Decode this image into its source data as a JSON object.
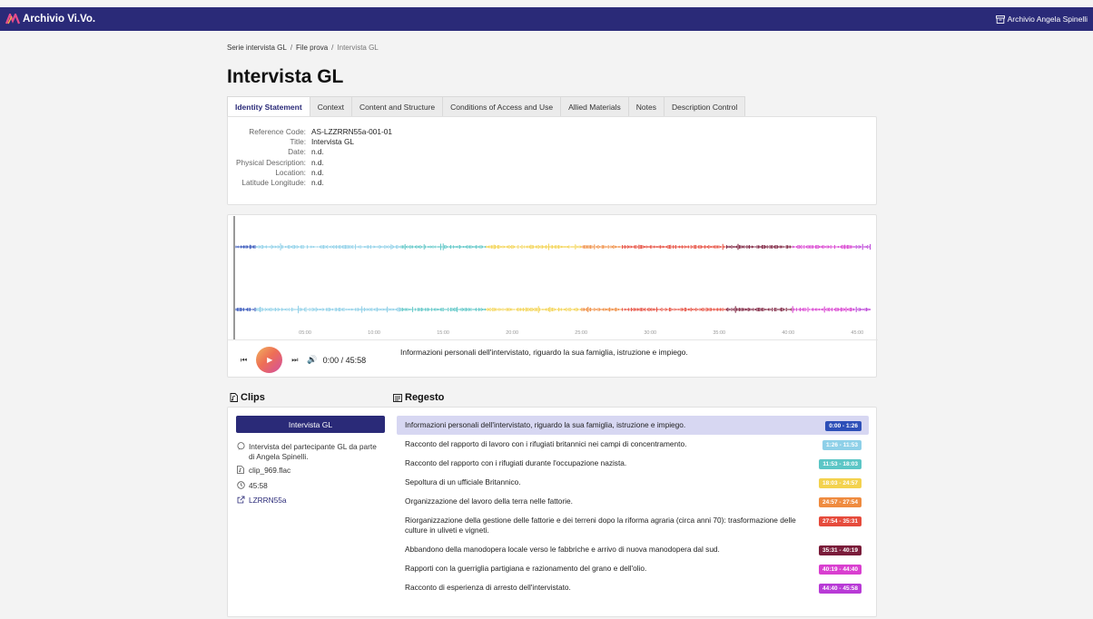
{
  "navbar": {
    "brand": "Archivio Vi.Vo.",
    "user": "Archivio Angela Spinelli"
  },
  "breadcrumb": {
    "items": [
      "Serie intervista GL",
      "File prova",
      "Intervista GL"
    ],
    "separator": "/"
  },
  "page": {
    "title": "Intervista GL"
  },
  "tabs": [
    {
      "label": "Identity Statement",
      "active": true
    },
    {
      "label": "Context"
    },
    {
      "label": "Content and Structure"
    },
    {
      "label": "Conditions of Access and Use"
    },
    {
      "label": "Allied Materials"
    },
    {
      "label": "Notes"
    },
    {
      "label": "Description Control"
    }
  ],
  "identity": {
    "rows": [
      {
        "label": "Reference Code:",
        "value": "AS-LZZRRN55a-001-01"
      },
      {
        "label": "Title:",
        "value": "Intervista GL"
      },
      {
        "label": "Date:",
        "value": "n.d."
      },
      {
        "label": "Physical Description:",
        "value": "n.d."
      },
      {
        "label": "Location:",
        "value": "n.d."
      },
      {
        "label": "Latitude Longitude:",
        "value": "n.d."
      }
    ]
  },
  "player": {
    "timeline_ticks": [
      "05:00",
      "10:00",
      "15:00",
      "20:00",
      "25:00",
      "30:00",
      "35:00",
      "40:00",
      "45:00"
    ],
    "current_time": "0:00 / 45:58",
    "now_text": "Informazioni personali dell'intervistato, riguardo la sua famiglia, istruzione e impiego.",
    "prev_icon": "⏮",
    "next_icon": "⏭",
    "volume_icon": "🔊",
    "play_icon": "▶"
  },
  "clips": {
    "title": "Clips",
    "button": "Intervista GL",
    "description": "Intervista del partecipante GL da parte di Angela Spinelli.",
    "file": "clip_969.flac",
    "duration": "45:58",
    "link": "LZRRN55a"
  },
  "regesto": {
    "title": "Regesto",
    "items": [
      {
        "text": "Informazioni personali dell'intervistato, riguardo la sua famiglia, istruzione e impiego.",
        "range": "0:00 - 1:26",
        "color": "#2d4fb8",
        "active": true
      },
      {
        "text": "Racconto del rapporto di lavoro con i rifugiati britannici nei campi di concentramento.",
        "range": "1:26 - 11:53",
        "color": "#8ed0e8"
      },
      {
        "text": "Racconto del rapporto con i rifugiati durante l'occupazione nazista.",
        "range": "11:53 - 18:03",
        "color": "#5cc6c6"
      },
      {
        "text": "Sepoltura di un ufficiale Britannico.",
        "range": "18:03 - 24:57",
        "color": "#f3d24e"
      },
      {
        "text": "Organizzazione del lavoro della terra nelle fattorie.",
        "range": "24:57 - 27:54",
        "color": "#ef8b3f"
      },
      {
        "text": "Riorganizzazione della gestione delle fattorie e dei terreni dopo la riforma agraria (circa anni 70): trasformazione delle culture in uliveti e vigneti.",
        "range": "27:54 - 35:31",
        "color": "#e64b3c"
      },
      {
        "text": "Abbandono della manodopera locale verso le fabbriche e arrivo di nuova manodopera dal sud.",
        "range": "35:31 - 40:19",
        "color": "#7a1c3a"
      },
      {
        "text": "Rapporti con la guerriglia partigiana e razionamento del grano e dell'olio.",
        "range": "40:19 - 44:40",
        "color": "#d93fd0"
      },
      {
        "text": "Racconto di esperienza di arresto dell'intervistato.",
        "range": "44:40 - 45:58",
        "color": "#b83ad6"
      }
    ]
  }
}
